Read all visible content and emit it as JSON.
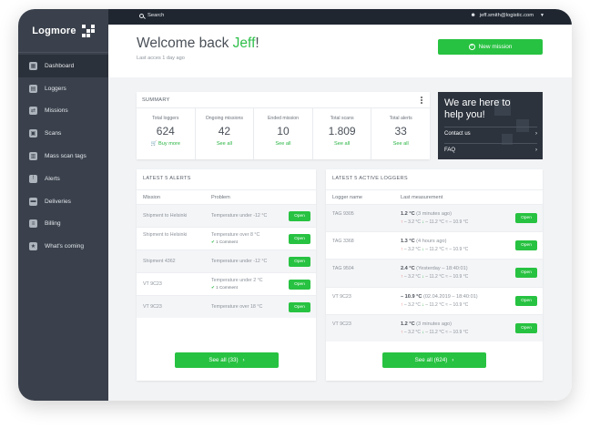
{
  "brand": {
    "name": "Logmore"
  },
  "topbar": {
    "search_label": "Search",
    "user_email": "jeff.smith@logistic.com"
  },
  "sidebar": {
    "items": [
      {
        "label": "Dashboard",
        "icon": "dashboard-icon",
        "active": true
      },
      {
        "label": "Loggers",
        "icon": "logger-icon"
      },
      {
        "label": "Missions",
        "icon": "missions-icon"
      },
      {
        "label": "Scans",
        "icon": "scan-icon"
      },
      {
        "label": "Mass scan tags",
        "icon": "mass-scan-icon"
      },
      {
        "label": "Alerts",
        "icon": "alert-icon"
      },
      {
        "label": "Deliveries",
        "icon": "truck-icon"
      },
      {
        "label": "Billing",
        "icon": "billing-icon"
      },
      {
        "label": "What's coming",
        "icon": "star-icon"
      }
    ]
  },
  "header": {
    "welcome_prefix": "Welcome back ",
    "user_name": "Jeff",
    "welcome_suffix": "!",
    "last_access": "Last acces 1 day ago",
    "new_mission_label": "New mission"
  },
  "summary": {
    "title": "SUMMARY",
    "stats": [
      {
        "label": "Total loggers",
        "value": "624",
        "link": "Buy more"
      },
      {
        "label": "Ongoing missions",
        "value": "42",
        "link": "See all"
      },
      {
        "label": "Ended mission",
        "value": "10",
        "link": "See all"
      },
      {
        "label": "Total scans",
        "value": "1.809",
        "link": "See all"
      },
      {
        "label": "Total alerts",
        "value": "33",
        "link": "See all"
      }
    ]
  },
  "help": {
    "title_line1": "We are here to",
    "title_line2": "help you!",
    "contact_label": "Contact us",
    "faq_label": "FAQ"
  },
  "alerts": {
    "title": "LATEST 5 ALERTS",
    "col_mission": "Mission",
    "col_problem": "Problem",
    "open_label": "Open",
    "rows": [
      {
        "mission": "Shipment to Helsinki",
        "problem": "Temperature under -12 °C",
        "comment": ""
      },
      {
        "mission": "Shipment to Helsinki",
        "problem": "Temperature over 8 °C",
        "comment": "1 Comment"
      },
      {
        "mission": "Shipment 4362",
        "problem": "Temperature under -12 °C",
        "comment": ""
      },
      {
        "mission": "VT 9C23",
        "problem": "Temperature under 2 °C",
        "comment": "1 Comment"
      },
      {
        "mission": "VT 9C23",
        "problem": "Temperature over 18 °C",
        "comment": ""
      }
    ],
    "see_all_label": "See all (33)"
  },
  "loggers": {
    "title": "LATEST 5 ACTIVE LOGGERS",
    "col_name": "Logger name",
    "col_measurement": "Last measurement",
    "open_label": "Open",
    "rows": [
      {
        "name": "TAG 9305",
        "temp": "1.2 °C",
        "when": "(3 minutes ago)",
        "high": "3.2 °C",
        "low": "11.2 °C",
        "avg": "10.9 °C"
      },
      {
        "name": "TAG 3368",
        "temp": "1.3 °C",
        "when": "(4 hours ago)",
        "high": "3.2 °C",
        "low": "11.2 °C",
        "avg": "10.9 °C"
      },
      {
        "name": "TAG 9504",
        "temp": "2.4 °C",
        "when": "(Yesterday – 18:40:01)",
        "high": "3.2 °C",
        "low": "11.2 °C",
        "avg": "10.9 °C"
      },
      {
        "name": "VT 9C23",
        "temp": "– 10.9 °C",
        "when": "(02.04.2019 – 18:40:01)",
        "high": "3.2 °C",
        "low": "11.2 °C",
        "avg": "10.9 °C"
      },
      {
        "name": "VT 9C23",
        "temp": "1.2 °C",
        "when": "(3 minutes ago)",
        "high": "3.2 °C",
        "low": "11.2 °C",
        "avg": "10.9 °C"
      }
    ],
    "see_all_label": "See all (624)"
  },
  "colors": {
    "accent": "#27c241",
    "sidebar": "#3a414c",
    "topbar": "#1f2630"
  }
}
